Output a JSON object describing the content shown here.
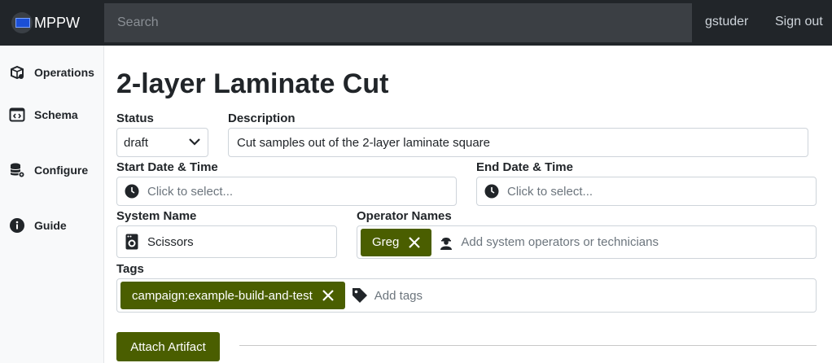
{
  "navbar": {
    "brand": "MPPW",
    "search_placeholder": "Search",
    "user": "gstuder",
    "signout": "Sign out"
  },
  "sidebar": {
    "items": [
      {
        "label": "Operations",
        "icon": "box-gear-icon"
      },
      {
        "label": "Schema",
        "icon": "code-window-icon"
      },
      {
        "label": "Configure",
        "icon": "database-gear-icon"
      },
      {
        "label": "Guide",
        "icon": "info-circle-icon"
      }
    ]
  },
  "page": {
    "title": "2-layer Laminate Cut"
  },
  "form": {
    "status_label": "Status",
    "status_value": "draft",
    "description_label": "Description",
    "description_value": "Cut samples out of the 2-layer laminate square",
    "start_label": "Start Date & Time",
    "start_placeholder": "Click to select...",
    "end_label": "End Date & Time",
    "end_placeholder": "Click to select...",
    "system_label": "System Name",
    "system_value": "Scissors",
    "operators_label": "Operator Names",
    "operators": [
      "Greg"
    ],
    "operators_placeholder": "Add system operators or technicians",
    "tags_label": "Tags",
    "tags": [
      "campaign:example-build-and-test"
    ],
    "tags_placeholder": "Add tags"
  },
  "actions": {
    "attach_label": "Attach Artifact"
  },
  "colors": {
    "navbar": "#212529",
    "accent": "#4a5e00",
    "sidebar_bg": "#f8f9fa"
  }
}
